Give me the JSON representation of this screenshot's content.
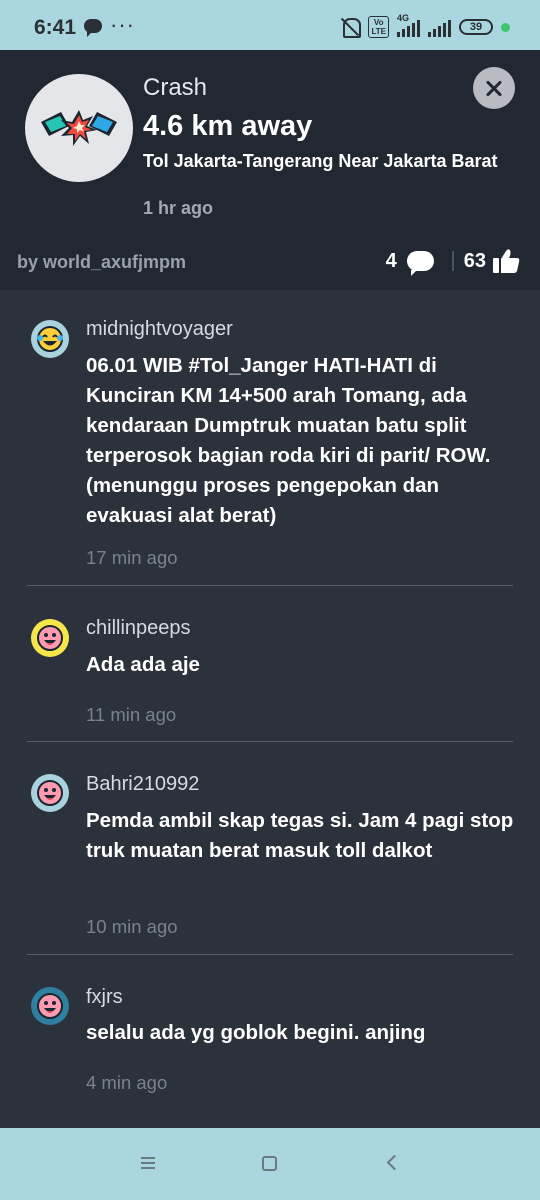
{
  "status_bar": {
    "time": "6:41",
    "dots": "···",
    "volte_label": "Vo\nLTE",
    "network_label": "4G",
    "battery": "39"
  },
  "alert": {
    "type": "Crash",
    "distance": "4.6 km away",
    "location": "Tol Jakarta-Tangerang Near Jakarta Barat",
    "time_ago": "1 hr ago",
    "reporter": "by world_axufjmpm",
    "comment_count": "4",
    "thanks_count": "63"
  },
  "comments": [
    {
      "user": "midnightvoyager",
      "text": "06.01 WIB #Tol_Janger HATI-HATI di Kunciran KM 14+500 arah Tomang, ada kendaraan Dumptruk muatan batu split terperosok bagian roda kiri di parit/ ROW. (menunggu proses pengepokan dan evakuasi alat berat)",
      "time": "17 min ago"
    },
    {
      "user": "chillinpeeps",
      "text": "Ada ada aje",
      "time": "11 min ago"
    },
    {
      "user": "Bahri210992",
      "text": "Pemda ambil skap tegas si. Jam 4 pagi stop truk muatan berat masuk toll dalkot",
      "time": "10 min ago"
    },
    {
      "user": "fxjrs",
      "text": "selalu ada yg goblok begini. anjing",
      "time": "4 min ago"
    }
  ],
  "colors": {
    "header_bg": "#212832",
    "comments_bg": "#2b323c",
    "system_bar": "#a9d6df",
    "online_dot": "#3ec66a"
  },
  "icons": {
    "crash": "crash-icon",
    "close": "close-icon",
    "comment": "comment-bubble-icon",
    "thanks": "thumbs-up-icon"
  }
}
